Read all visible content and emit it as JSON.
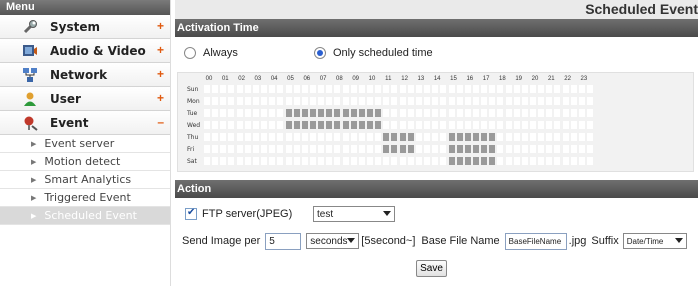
{
  "menu": {
    "header": "Menu",
    "items": [
      {
        "label": "System",
        "sign": "+",
        "icon": "wrench-icon"
      },
      {
        "label": "Audio & Video",
        "sign": "+",
        "icon": "camera-icon"
      },
      {
        "label": "Network",
        "sign": "+",
        "icon": "network-icon"
      },
      {
        "label": "User",
        "sign": "+",
        "icon": "user-icon"
      },
      {
        "label": "Event",
        "sign": "–",
        "icon": "event-icon"
      }
    ],
    "sub_items": [
      {
        "label": "Event server",
        "active": false
      },
      {
        "label": "Motion detect",
        "active": false
      },
      {
        "label": "Smart Analytics",
        "active": false
      },
      {
        "label": "Triggered Event",
        "active": false
      },
      {
        "label": "Scheduled Event",
        "active": true
      }
    ]
  },
  "page": {
    "title": "Scheduled Event"
  },
  "activation": {
    "header": "Activation Time",
    "always_label": "Always",
    "scheduled_label": "Only scheduled time",
    "selected": "scheduled"
  },
  "schedule": {
    "hours": [
      "00",
      "01",
      "02",
      "03",
      "04",
      "05",
      "06",
      "07",
      "08",
      "09",
      "10",
      "11",
      "12",
      "13",
      "14",
      "15",
      "16",
      "17",
      "18",
      "19",
      "20",
      "21",
      "22",
      "23"
    ],
    "days": [
      "Sun",
      "Mon",
      "Tue",
      "Wed",
      "Thu",
      "Fri",
      "Sat"
    ],
    "active_slots": {
      "Tue": [
        [
          5,
          10
        ]
      ],
      "Wed": [
        [
          5,
          10
        ]
      ],
      "Thu": [
        [
          11,
          12
        ],
        [
          15,
          17
        ]
      ],
      "Fri": [
        [
          11,
          12
        ],
        [
          15,
          17
        ]
      ],
      "Sat": [
        [
          15,
          17
        ]
      ]
    }
  },
  "action": {
    "header": "Action",
    "ftp_checked": true,
    "ftp_label": "FTP server(JPEG)",
    "ftp_server": "test",
    "send_label": "Send Image per",
    "interval_value": "5",
    "interval_unit": "seconds",
    "interval_hint": "[5second~]",
    "basename_label": "Base File Name",
    "basename_value": "BaseFileName",
    "ext": ".jpg",
    "suffix_label": "Suffix",
    "suffix_value": "Date/Time",
    "save_label": "Save"
  },
  "colors": {
    "accent_sign": "#e05a10",
    "slot_on": "#9a9a9a",
    "header_bg": "#555555"
  }
}
